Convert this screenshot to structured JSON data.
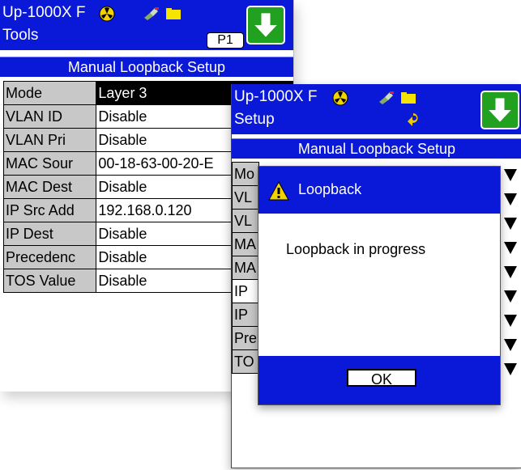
{
  "back_screen": {
    "device_name": "Up-1000X F",
    "mode_label": "Tools",
    "page_tab": "P1",
    "section_title": "Manual Loopback Setup",
    "rows": [
      {
        "label": "Mode",
        "value": "Layer 3"
      },
      {
        "label": "VLAN ID",
        "value": "Disable"
      },
      {
        "label": "VLAN Pri",
        "value": "Disable"
      },
      {
        "label": "MAC Sour",
        "value": "00-18-63-00-20-E"
      },
      {
        "label": "MAC Dest",
        "value": "Disable"
      },
      {
        "label": "IP Src Add",
        "value": "192.168.0.120"
      },
      {
        "label": "IP Dest",
        "value": "Disable"
      },
      {
        "label": "Precedenc",
        "value": "Disable"
      },
      {
        "label": "TOS Value",
        "value": "Disable"
      }
    ]
  },
  "front_screen": {
    "device_name": "Up-1000X F",
    "mode_label": "Setup",
    "section_title": "Manual Loopback Setup",
    "row_labels": [
      "Mo",
      "VL",
      "VL",
      "MA",
      "MA",
      "IP",
      "IP",
      "Pre",
      "TO"
    ]
  },
  "dialog": {
    "title": "Loopback",
    "message": "Loopback in progress",
    "ok_label": "OK"
  },
  "colors": {
    "header_blue": "#0a18d8",
    "go_green": "#22a020",
    "label_gray": "#c8c8c8",
    "warning_yellow": "#f2d200"
  },
  "icons": [
    "fan-icon",
    "network-plug-icon",
    "folder-icon",
    "down-arrow-button-icon",
    "warning-icon",
    "dropdown-arrow-icon",
    "return-arrow-icon"
  ]
}
